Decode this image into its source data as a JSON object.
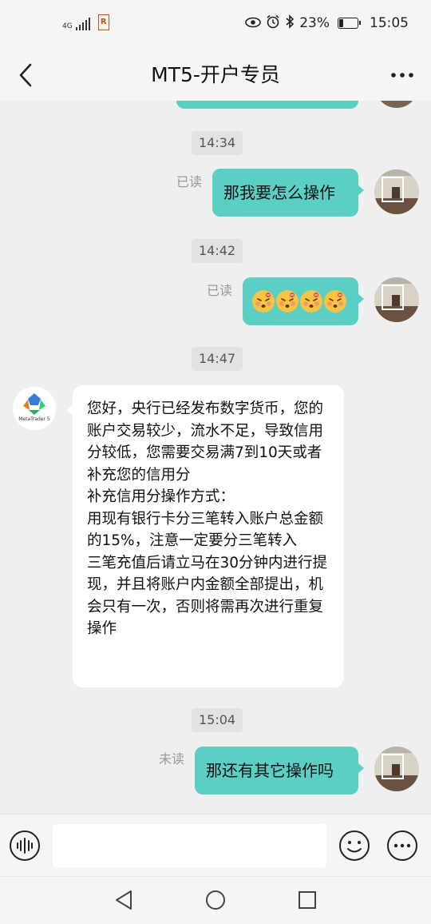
{
  "status_bar": {
    "network": "4G",
    "app_badge": "R",
    "battery_percent": "23%",
    "battery_level": 0.23,
    "time": "15:05"
  },
  "header": {
    "title": "MT5-开户专员"
  },
  "messages": {
    "time_1": "14:34",
    "out_1": {
      "text": "那我要怎么操作",
      "status": "已读"
    },
    "time_2": "14:42",
    "out_2": {
      "status": "已读",
      "emoji_count": 4,
      "emoji_name": "dizzy-face-emoji"
    },
    "time_3": "14:47",
    "in_1": {
      "text": "您好，央行已经发布数字货币，您的账户交易较少，流水不足，导致信用分较低，您需要交易满7到10天或者补充您的信用分\n补充信用分操作方式：\n用现有银行卡分三笔转入账户总金额的15%，注意一定要分三笔转入\n三笔充值后请立马在30分钟内进行提现，并且将账户内金额全部提出，机会只有一次，否则将需再次进行重复操作",
      "avatar_label": "MetaTrader 5"
    },
    "time_4": "15:04",
    "out_3": {
      "text": "那还有其它操作吗",
      "status": "未读"
    }
  },
  "input": {
    "value": "",
    "placeholder": ""
  },
  "colors": {
    "outgoing_bubble": "#5bcfc4",
    "incoming_bubble": "#ffffff",
    "background": "#efefef"
  }
}
